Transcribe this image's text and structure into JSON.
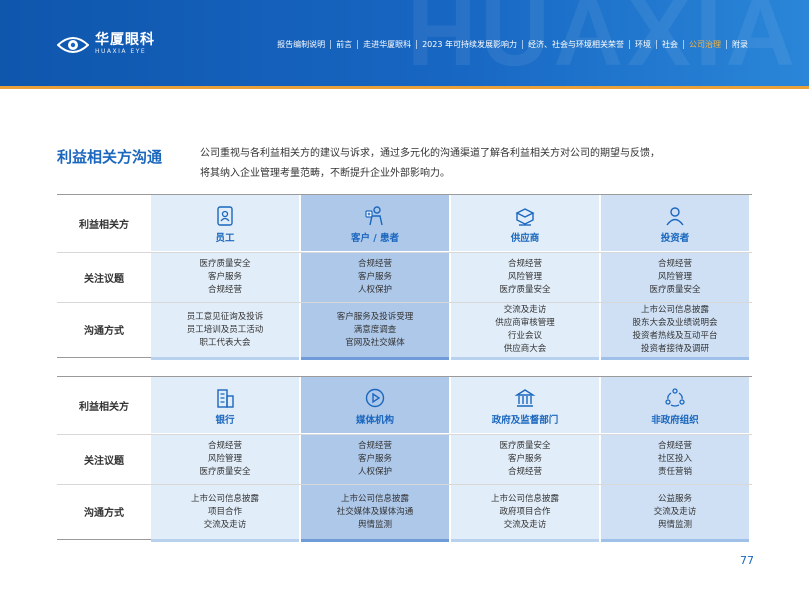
{
  "header": {
    "logo_cn": "华厦眼科",
    "logo_en": "HUAXIA EYE",
    "nav": [
      {
        "label": "报告编制说明",
        "active": false
      },
      {
        "label": "前言",
        "active": false
      },
      {
        "label": "走进华厦眼科",
        "active": false
      },
      {
        "label": "2023 年可持续发展影响力",
        "active": false
      },
      {
        "label": "经济、社会与环境相关荣誉",
        "active": false
      },
      {
        "label": "环境",
        "active": false
      },
      {
        "label": "社会",
        "active": false
      },
      {
        "label": "公司治理",
        "active": true
      },
      {
        "label": "附录",
        "active": false
      }
    ],
    "colors": {
      "bar": "#1766c2",
      "accent": "#e9a23b",
      "active": "#f3b442"
    }
  },
  "section": {
    "title": "利益相关方沟通",
    "intro_line1": "公司重视与各利益相关方的建议与诉求，通过多元化的沟通渠道了解各利益相关方对公司的期望与反馈，",
    "intro_line2": "将其纳入企业管理考量范畴，不断提升企业外部影响力。"
  },
  "row_labels": {
    "stakeholder": "利益相关方",
    "topics": "关注议题",
    "channels": "沟通方式"
  },
  "tables": [
    {
      "stakeholders": [
        {
          "name": "员工",
          "icon": "id-badge-icon",
          "topics": [
            "医疗质量安全",
            "客户服务",
            "合规经营"
          ],
          "channels": [
            "员工意见征询及投诉",
            "员工培训及员工活动",
            "职工代表大会"
          ]
        },
        {
          "name": "客户 / 患者",
          "icon": "patient-icon",
          "topics": [
            "合规经营",
            "客户服务",
            "人权保护"
          ],
          "channels": [
            "客户服务及投诉受理",
            "满意度调查",
            "官网及社交媒体"
          ]
        },
        {
          "name": "供应商",
          "icon": "supply-box-icon",
          "topics": [
            "合规经营",
            "风险管理",
            "医疗质量安全"
          ],
          "channels": [
            "交流及走访",
            "供应商审核管理",
            "行业会议",
            "供应商大会"
          ]
        },
        {
          "name": "投资者",
          "icon": "investor-person-icon",
          "topics": [
            "合规经营",
            "风险管理",
            "医疗质量安全"
          ],
          "channels": [
            "上市公司信息披露",
            "股东大会及业绩说明会",
            "投资者热线及互动平台",
            "投资者接待及调研"
          ]
        }
      ]
    },
    {
      "stakeholders": [
        {
          "name": "银行",
          "icon": "bank-building-icon",
          "topics": [
            "合规经营",
            "风险管理",
            "医疗质量安全"
          ],
          "channels": [
            "上市公司信息披露",
            "项目合作",
            "交流及走访"
          ]
        },
        {
          "name": "媒体机构",
          "icon": "media-play-icon",
          "topics": [
            "合规经营",
            "客户服务",
            "人权保护"
          ],
          "channels": [
            "上市公司信息披露",
            "社交媒体及媒体沟通",
            "舆情监测"
          ]
        },
        {
          "name": "政府及监督部门",
          "icon": "government-icon",
          "topics": [
            "医疗质量安全",
            "客户服务",
            "合规经营"
          ],
          "channels": [
            "上市公司信息披露",
            "政府项目合作",
            "交流及走访"
          ]
        },
        {
          "name": "非政府组织",
          "icon": "community-circle-icon",
          "topics": [
            "合规经营",
            "社区投入",
            "责任营销"
          ],
          "channels": [
            "公益服务",
            "交流及走访",
            "舆情监测"
          ]
        }
      ]
    }
  ],
  "column_colors": [
    "#e1edf8",
    "#aec8ea",
    "#e1edf8",
    "#cfe0f4"
  ],
  "column_bar_colors": [
    "#b8d1ee",
    "#6f9cd8",
    "#b8d1ee",
    "#9fc0e8"
  ],
  "page_number": "77"
}
